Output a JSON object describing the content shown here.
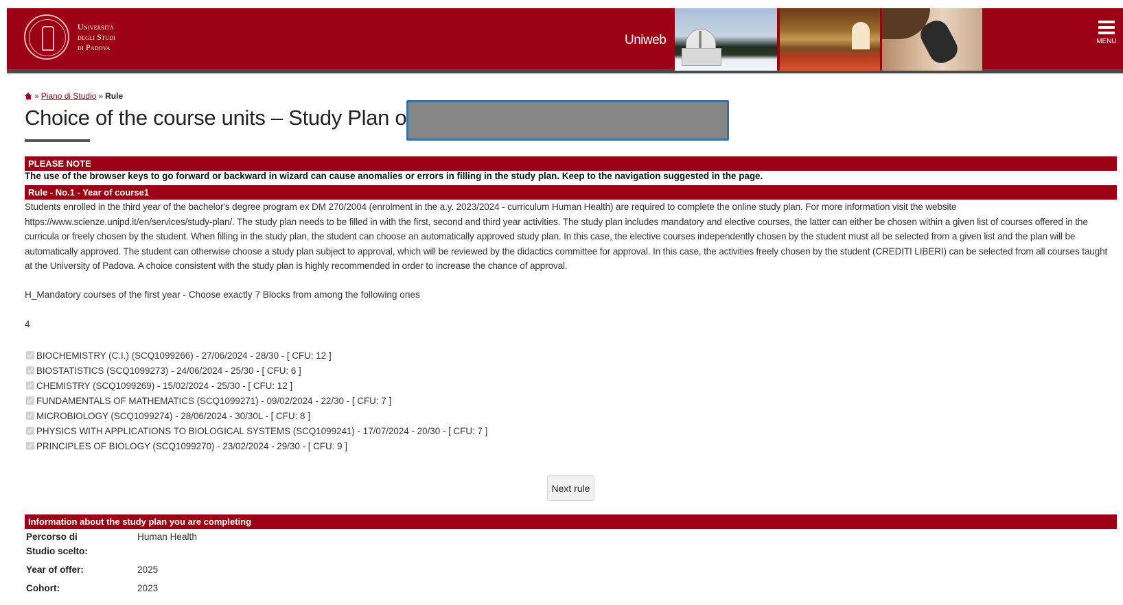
{
  "header": {
    "logo_line1": "Università",
    "logo_line2": "degli Studi",
    "logo_line3": "di Padova",
    "app_name": "Uniweb",
    "menu_label": "MENU"
  },
  "breadcrumb": {
    "separator": "»",
    "link": "Piano di Studio",
    "current": "Rule"
  },
  "page": {
    "title": "Choice of the course units – Study Plan of"
  },
  "notice": {
    "heading": "PLEASE NOTE",
    "text": "The use of the browser keys to go forward or backward in wizard can cause anomalies or errors in filling in the study plan. Keep to the navigation suggested in the page."
  },
  "rule": {
    "heading": "Rule - No.1 - Year of course1",
    "description": "Students enrolled in the third year of the bachelor's degree program ex DM 270/2004 (enrolment in the a.y. 2023/2024 - curriculum Human Health) are required to complete the online study plan. For more information visit the website https://www.scienze.unipd.it/en/services/study-plan/. The study plan needs to be filled in with the first, second and third year activities. The study plan includes mandatory and elective courses, the latter can either be chosen within a given list of courses offered in the curricula or freely chosen by the student. When filling in the study plan, the student can choose an automatically approved study plan. In this case, the elective courses independently chosen by the student must all be selected from a given list and the plan will be automatically approved. The student can otherwise choose a study plan subject to approval, which will be reviewed by the didactics committee for approval. In this case, the activities freely chosen by the student (CREDITI LIBERI) can be selected from all courses taught at the University of Padova. A choice consistent with the study plan is highly recommended in order to increase the chance of approval.",
    "block_instruction": "H_Mandatory courses of the first year - Choose exactly 7 Blocks from among the following ones",
    "block_number": "4",
    "courses": [
      {
        "label": "BIOCHEMISTRY (C.I.) (SCQ1099266) - 27/06/2024 - 28/30 - [ CFU: 12 ]",
        "checked": true
      },
      {
        "label": "BIOSTATISTICS (SCQ1099273) - 24/06/2024 - 25/30 - [ CFU: 6 ]",
        "checked": true
      },
      {
        "label": "CHEMISTRY (SCQ1099269) - 15/02/2024 - 25/30 - [ CFU: 12 ]",
        "checked": true
      },
      {
        "label": "FUNDAMENTALS OF MATHEMATICS (SCQ1099271) - 09/02/2024 - 22/30 - [ CFU: 7 ]",
        "checked": true
      },
      {
        "label": "MICROBIOLOGY (SCQ1099274) - 28/06/2024 - 30/30L - [ CFU: 8 ]",
        "checked": true
      },
      {
        "label": "PHYSICS WITH APPLICATIONS TO BIOLOGICAL SYSTEMS (SCQ1099241) - 17/07/2024 - 20/30 - [ CFU: 7 ]",
        "checked": true
      },
      {
        "label": "PRINCIPLES OF BIOLOGY (SCQ1099270) - 23/02/2024 - 29/30 - [ CFU: 9 ]",
        "checked": true
      }
    ],
    "next_button": "Next rule"
  },
  "info": {
    "heading": "Information about the study plan you are completing",
    "rows": [
      {
        "label": "Percorso di Studio scelto:",
        "value": "Human Health"
      },
      {
        "label": "Year of offer:",
        "value": "2025"
      },
      {
        "label": "Cohort:",
        "value": "2023"
      }
    ]
  },
  "colors": {
    "brand_red": "#9b0014",
    "redaction_gray": "#868686",
    "redaction_border": "#3a6ea5"
  },
  "icons": {
    "home": "home-icon",
    "menu": "hamburger-menu-icon",
    "logo": "university-seal-logo"
  }
}
